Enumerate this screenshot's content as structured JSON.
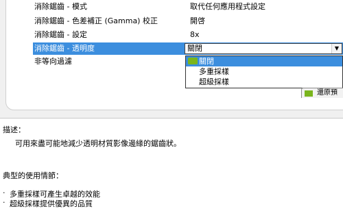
{
  "settings": [
    {
      "name": "消除鋸齒 - 模式",
      "value": "取代任何應用程式設定"
    },
    {
      "name": "消除鋸齒 - 色差補正 (Gamma) 校正",
      "value": "開啓"
    },
    {
      "name": "消除鋸齒 - 設定",
      "value": "8x"
    },
    {
      "name": "消除鋸齒 - 透明度",
      "value": ""
    },
    {
      "name": "非等向過濾",
      "value": ""
    }
  ],
  "dropdown": {
    "selected": "關閉",
    "arrow": "▼",
    "options": [
      "關閉",
      "多重採樣",
      "超級採樣"
    ]
  },
  "button": {
    "label": "還原預"
  },
  "description": {
    "heading": "描述：",
    "text": "可用來盡可能地減少透明材質影像邊緣的鋸齒狀。"
  },
  "usage": {
    "heading": "典型的使用情節：",
    "items": [
      "多重採樣可產生卓越的效能",
      "超級採樣提供優異的品質"
    ]
  },
  "colors": {
    "selection": "#3c8ede",
    "nvidia_green": "#7ab51d"
  }
}
